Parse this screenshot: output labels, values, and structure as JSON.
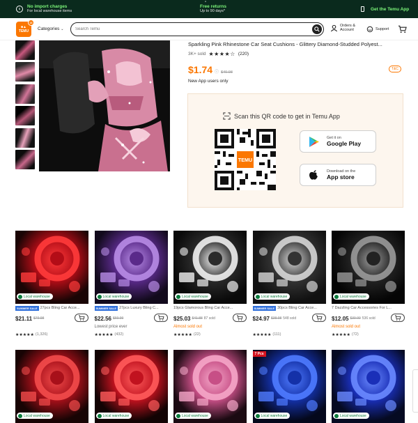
{
  "topbar": {
    "item1_title": "No import charges",
    "item1_sub": "For local warehouse items",
    "item2_title": "Free returns",
    "item2_sub": "Up to 90 days*",
    "item3_title": "Get the Temu App"
  },
  "header": {
    "logo_text": "TEMU",
    "categories": "Categories",
    "search_placeholder": "Search Temu",
    "orders": "Orders &",
    "account": "Account",
    "support": "Support"
  },
  "product": {
    "title": "Sparkling Pink Rhinestone Car Seat Cushions - Glittery Diamond-Studded Polyest...",
    "sold": "3K+ sold",
    "rating": 4.5,
    "reviews": "(220)",
    "price": "$1.74",
    "old_price": "$40.98",
    "new_users": "New App users only",
    "tc": "T&C"
  },
  "qr_panel": {
    "title": "Scan this QR code to get in Temu App",
    "gp_line1": "Get it on",
    "gp_line2": "Google Play",
    "as_line1": "Download on the",
    "as_line2": "App store"
  },
  "local_label": "Local warehouse",
  "summer_badge": "SUMMER SALE",
  "cards": [
    {
      "title": "27pcs Bling Car Acce...",
      "summer": true,
      "price": "$21.11",
      "old": "$79.98",
      "sold": "",
      "note": "",
      "rating": "(1,326)",
      "theme": "red"
    },
    {
      "title": "27pcs Luxury Bling C...",
      "summer": true,
      "price": "$22.56",
      "old": "$69.99",
      "sold": "",
      "note": "Lowest price ever",
      "rating": "(432)",
      "theme": "purple"
    },
    {
      "title": "19pcs Glamorous Bling Car Acce...",
      "summer": false,
      "price": "$25.03",
      "old": "$41.88",
      "sold": "87 sold",
      "note": "Almost sold out",
      "rating": "(22)",
      "theme": "white"
    },
    {
      "title": "30pcs Bling Car Acce...",
      "summer": true,
      "price": "$24.97",
      "old": "$38.98",
      "sold": "548 sold",
      "note": "",
      "rating": "(111)",
      "theme": "silver"
    },
    {
      "title": "7 Dazzling Car Accessories For L...",
      "summer": false,
      "price": "$12.05",
      "old": "$39.99",
      "sold": "536 sold",
      "note": "Almost sold out",
      "rating": "(72)",
      "theme": "dark"
    },
    {
      "title": "",
      "theme": "red2"
    },
    {
      "title": "",
      "theme": "red3"
    },
    {
      "title": "",
      "theme": "pink"
    },
    {
      "title": "",
      "theme": "blue",
      "tag": "7 Pcs"
    },
    {
      "title": "",
      "theme": "blue2"
    }
  ]
}
